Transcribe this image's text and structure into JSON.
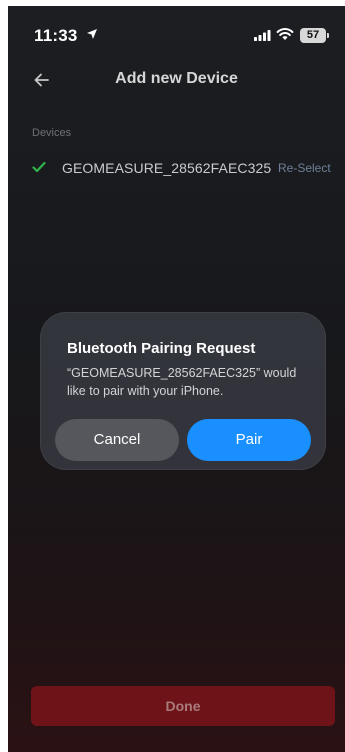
{
  "status_bar": {
    "time": "11:33",
    "battery": "57",
    "icons": [
      "location-arrow-icon",
      "cellular-signal-icon",
      "wifi-icon",
      "battery-icon"
    ]
  },
  "header": {
    "title": "Add new Device",
    "back_icon": "arrow-left-icon"
  },
  "devices": {
    "section_label": "Devices",
    "items": [
      {
        "name": "GEOMEASURE_28562FAEC325",
        "action": "Re-Select",
        "status_icon": "checkmark-icon"
      }
    ]
  },
  "alert": {
    "title": "Bluetooth Pairing Request",
    "message": "“GEOMEASURE_28562FAEC325” would like to pair with your iPhone.",
    "cancel_label": "Cancel",
    "confirm_label": "Pair"
  },
  "footer": {
    "done_label": "Done"
  },
  "colors": {
    "accent_blue": "#1a8fff",
    "success_green": "#2fb34d",
    "done_red": "#6e1418"
  }
}
